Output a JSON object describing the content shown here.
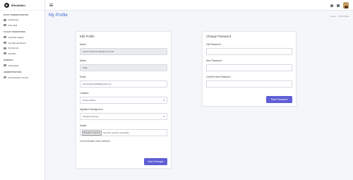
{
  "brand": {
    "logo_letter": "E",
    "name": "iEtsAdmin"
  },
  "sidebar": {
    "sections": [
      {
        "title": "PILOT ADMINISTRATION",
        "items": [
          {
            "label": "Dashboard",
            "icon": "dashboard-icon"
          },
          {
            "label": "Flow Mail",
            "icon": "mail-icon"
          }
        ]
      },
      {
        "title": "FLIGHT OPERATIONS",
        "items": [
          {
            "label": "Schedule Flights",
            "icon": "calendar-icon"
          },
          {
            "label": "File Manual Report",
            "icon": "file-icon"
          },
          {
            "label": "My Reports",
            "icon": "reports-icon"
          },
          {
            "label": "My Bids",
            "icon": "bids-icon"
          }
        ]
      },
      {
        "title": "GENERAL",
        "items": [
          {
            "label": "Downloads",
            "icon": "download-icon"
          }
        ]
      },
      {
        "title": "ADMINISTRATION",
        "items": [
          {
            "label": "Administration Center",
            "icon": "gear-icon"
          }
        ]
      }
    ]
  },
  "header": {
    "title": "My Profile",
    "breadcrumb": [
      "Home",
      "/",
      "My Profile"
    ]
  },
  "edit_profile": {
    "title": "Edit Profile",
    "name_label": "Name",
    "name_value": "Carlos Eduardo Marques Freitas",
    "airline_label": "Airline",
    "airline_value": "CDE",
    "email_label": "Email",
    "email_value": "carlosedfreitas85@gmail.com",
    "location_label": "Location",
    "location_value": "United States",
    "sigbg_label": "Signature Background",
    "sigbg_value": "background.png",
    "avatar_label": "Avatar",
    "file_button": "Escolher Arquivo",
    "file_status": "Nenhum arquivo escolhido",
    "current_avatar": "Current Avatar: None selected",
    "save_label": "Save Changes"
  },
  "change_password": {
    "title": "Change Password",
    "old_label": "Old Password",
    "new_label": "New Password",
    "confirm_label": "Confirm New Password",
    "save_label": "Save Password"
  },
  "colors": {
    "accent": "#3f6ad8",
    "button": "#5f5ed6"
  }
}
